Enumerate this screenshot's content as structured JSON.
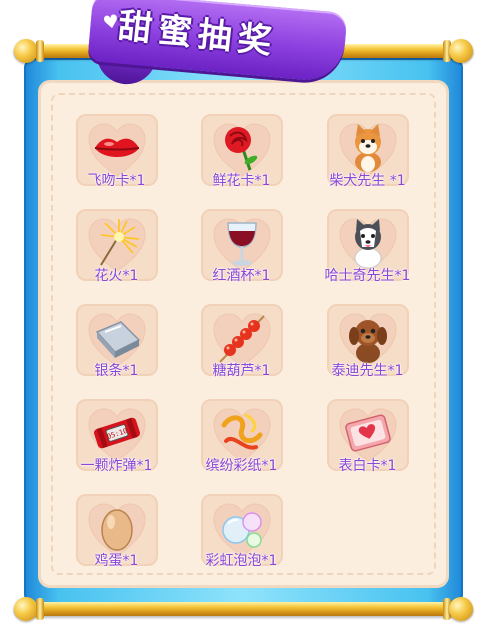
{
  "title": "甜蜜抽奖",
  "colors": {
    "frame_blue": "#48c2f0",
    "ribbon_purple": "#8b3fde",
    "label_purple": "#8a47d8",
    "panel_cream": "#fbeede",
    "rod_gold": "#f5c73c"
  },
  "items": [
    {
      "label": "飞吻卡*1",
      "icon": "lips-icon"
    },
    {
      "label": "鲜花卡*1",
      "icon": "rose-icon"
    },
    {
      "label": "柴犬先生 *1",
      "icon": "shiba-dog-icon"
    },
    {
      "label": "花火*1",
      "icon": "sparkler-icon"
    },
    {
      "label": "红酒杯*1",
      "icon": "wine-glass-icon"
    },
    {
      "label": "哈士奇先生*1",
      "icon": "husky-dog-icon"
    },
    {
      "label": "银条*1",
      "icon": "silver-bar-icon"
    },
    {
      "label": "糖葫芦*1",
      "icon": "candied-haws-icon"
    },
    {
      "label": "泰迪先生*1",
      "icon": "teddy-dog-icon"
    },
    {
      "label": "一颗炸弹*1",
      "icon": "bomb-icon"
    },
    {
      "label": "缤纷彩纸*1",
      "icon": "confetti-icon"
    },
    {
      "label": "表白卡*1",
      "icon": "love-card-icon"
    },
    {
      "label": "鸡蛋*1",
      "icon": "egg-icon"
    },
    {
      "label": "彩虹泡泡*1",
      "icon": "rainbow-bubbles-icon"
    }
  ]
}
